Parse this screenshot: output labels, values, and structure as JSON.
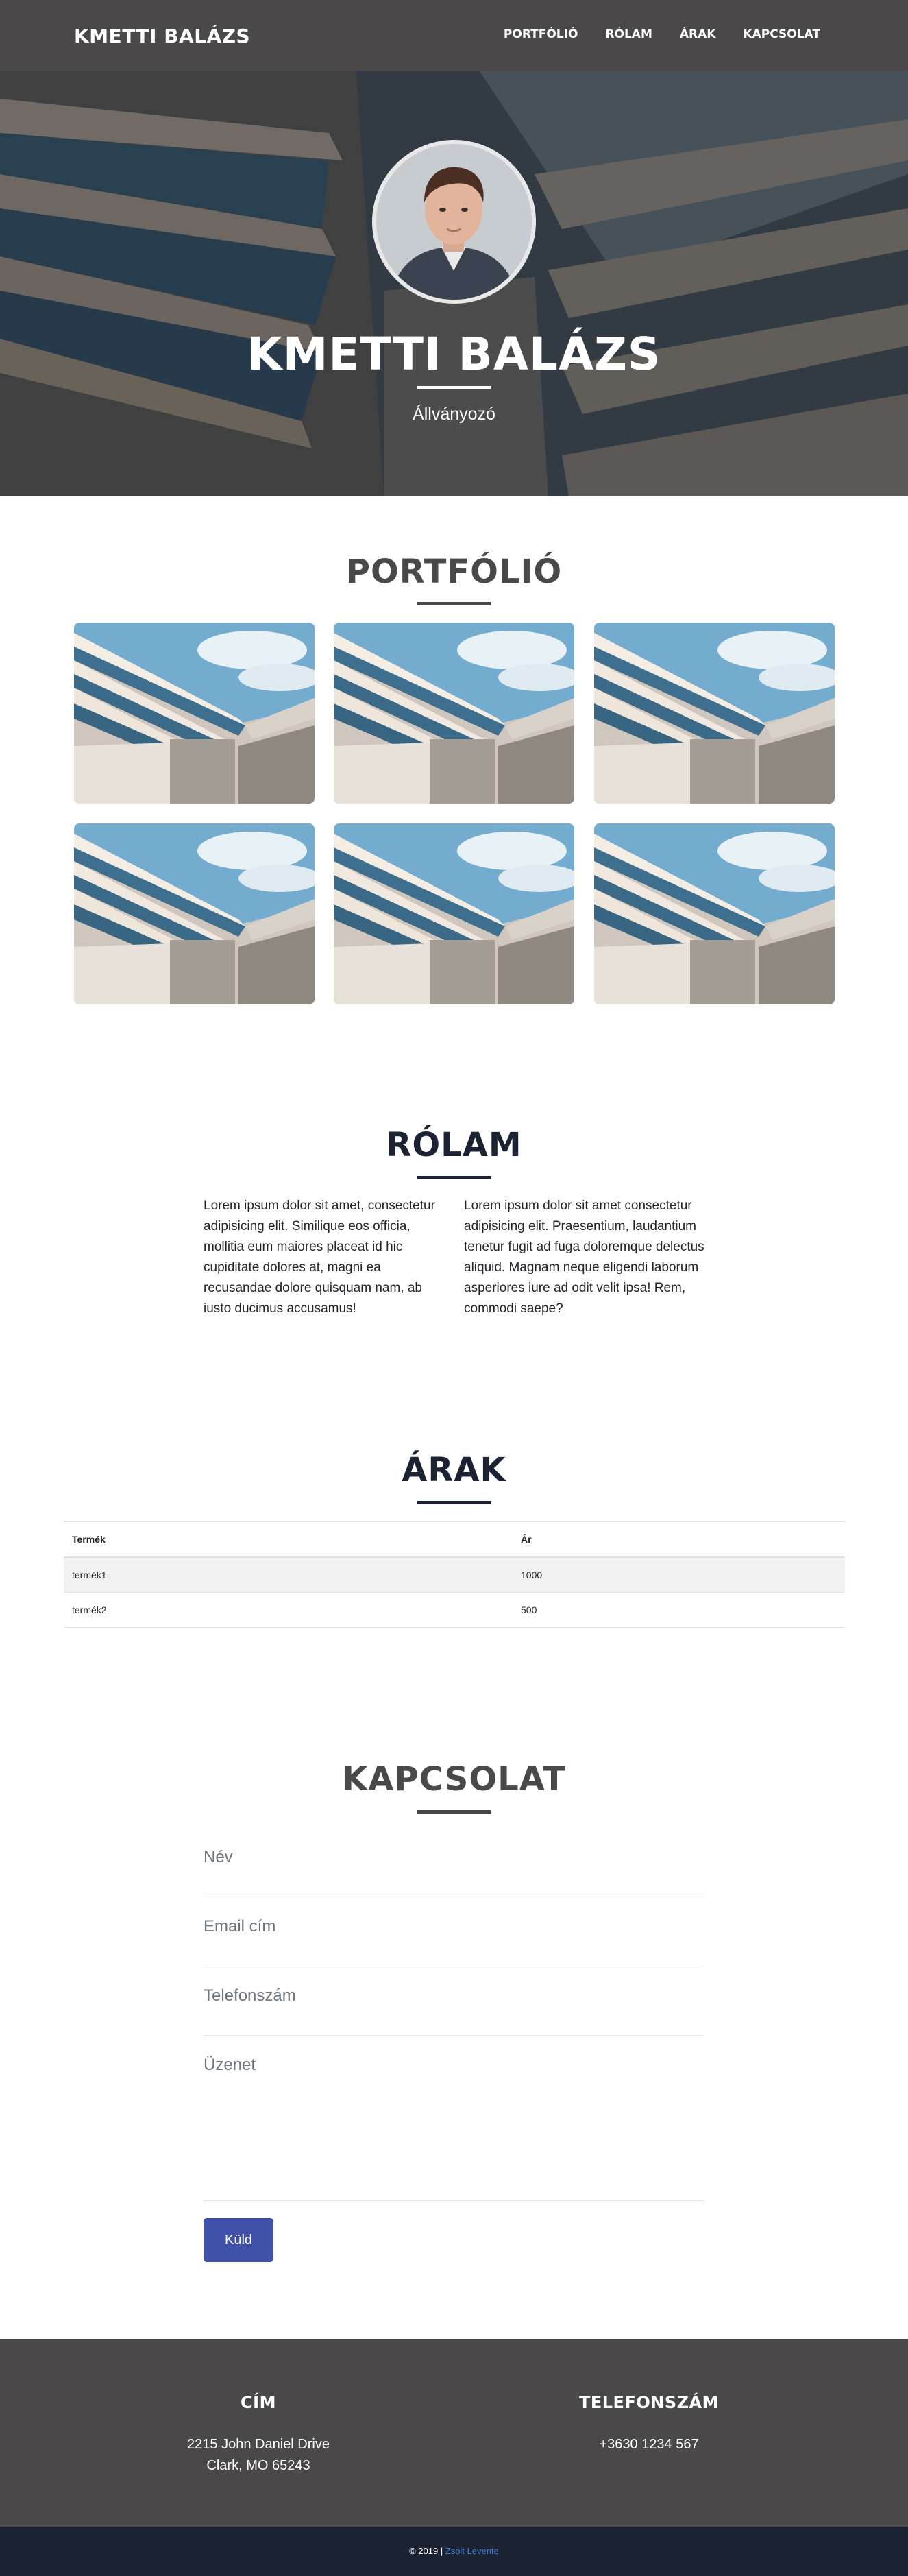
{
  "navbar": {
    "brand": "KMETTI BALÁZS",
    "links": [
      "PORTFÓLIÓ",
      "RÓLAM",
      "ÁRAK",
      "KAPCSOLAT"
    ]
  },
  "hero": {
    "name": "KMETTI BALÁZS",
    "subtitle": "Állványozó"
  },
  "portfolio": {
    "title": "PORTFÓLIÓ",
    "items": 6
  },
  "about": {
    "title": "RÓLAM",
    "left": "Lorem ipsum dolor sit amet, consectetur adipisicing elit. Similique eos officia, mollitia eum maiores placeat id hic cupiditate dolores at, magni ea recusandae dolore quisquam nam, ab iusto ducimus accusamus!",
    "right": "Lorem ipsum dolor sit amet consectetur adipisicing elit. Praesentium, laudantium tenetur fugit ad fuga doloremque delectus aliquid. Magnam neque eligendi laborum asperiores iure ad odit velit ipsa! Rem, commodi saepe?"
  },
  "prices": {
    "title": "ÁRAK",
    "columns": [
      "Termék",
      "Ár"
    ],
    "rows": [
      [
        "termék1",
        "1000"
      ],
      [
        "termék2",
        "500"
      ]
    ]
  },
  "contact": {
    "title": "KAPCSOLAT",
    "name_placeholder": "Név",
    "email_placeholder": "Email cím",
    "phone_placeholder": "Telefonszám",
    "message_placeholder": "Üzenet",
    "send_label": "Küld"
  },
  "footer": {
    "address_title": "CÍM",
    "address_line1": "2215 John Daniel Drive",
    "address_line2": "Clark, MO 65243",
    "phone_title": "TELEFONSZÁM",
    "phone": "+3630 1234 567",
    "copyright_prefix": "© 2019 |",
    "copyright_link": "Zsolt Levente"
  },
  "colors": {
    "navbar_bg": "#4a4848",
    "accent_button": "#3f51a8",
    "heading_dark": "#4a4848",
    "heading_black": "#1b2332",
    "copyright_bg": "#1b2332"
  }
}
